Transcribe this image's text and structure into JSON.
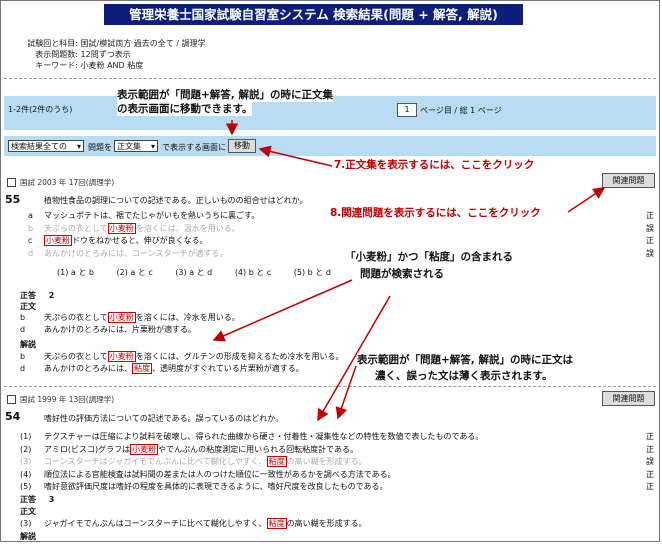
{
  "title": "管理栄養士国家試験自習室システム 検索結果(問題 + 解答, 解説)",
  "meta": {
    "subject_label": "試験回と科目:",
    "subject_value": "国試/模試両方 過去の全て / 調理学",
    "count_label": "表示問題数:",
    "count_value": "12問ずつ表示",
    "keyword_label": "キーワード:",
    "keyword_value": "小麦粉 AND 粘度"
  },
  "pagebar": {
    "range": "1-2件(2件のうち)",
    "page_value": "1",
    "page_suffix": "ページ目 / 総 1 ページ"
  },
  "controls": {
    "select1": "検索結果全ての",
    "mid_text": "問題を",
    "select2": "正文集",
    "after_text": "で表示する画面に",
    "move_button": "移動"
  },
  "q1": {
    "header": "国試 2003 年 17回(調理学)",
    "number": "55",
    "stem": "植物性食品の調理についての記述である。正しいものの組合せはどれか。",
    "related_button": "関連問題",
    "options": [
      {
        "letter": "a",
        "pre": "マッシュポテトは、裾でたじゃがいもを熱いうちに裏ごす。",
        "kw": "",
        "post": "",
        "mark": "正",
        "gray": false
      },
      {
        "letter": "b",
        "pre": "天ぷらの衣として",
        "kw": "小麦粉",
        "post": "を溶くには、温水を用いる。",
        "mark": "誤",
        "gray": true
      },
      {
        "letter": "c",
        "pre": "",
        "kw": "小麦粉",
        "post": "ドウをねかせると、伸びが良くなる。",
        "mark": "正",
        "gray": false
      },
      {
        "letter": "d",
        "pre": "あんかけのとろみには、コーンスターチが適する。",
        "kw": "",
        "post": "",
        "mark": "誤",
        "gray": true
      }
    ],
    "choices": [
      "(1) a と b",
      "(2) a と c",
      "(3) a と d",
      "(4) b と c",
      "(5) b と d"
    ],
    "answer_label": "正答",
    "answer_value": "2",
    "text_label": "正文",
    "correct": [
      {
        "letter": "b",
        "pre": "天ぷらの衣として",
        "kw": "小麦粉",
        "post": "を溶くには、冷水を用いる。"
      },
      {
        "letter": "d",
        "pre": "あんかけのとろみには、片栗粉が適する。",
        "kw": "",
        "post": ""
      }
    ],
    "explain_label": "解説",
    "explain": [
      {
        "letter": "b",
        "pre": "天ぷらの衣として",
        "kw": "小麦粉",
        "post": "を溶くには、グルテンの形成を抑えるため冷水を用いる。"
      },
      {
        "letter": "d",
        "pre": "あんかけのとろみには、",
        "kw": "粘度",
        "post": "、透明度がすぐれている片栗粉が適する。"
      }
    ]
  },
  "q2": {
    "header": "国試 1999 年 13回(調理学)",
    "number": "54",
    "stem": "嗜好性の評価方法についての記述である。誤っているのはどれか。",
    "related_button": "関連問題",
    "options": [
      {
        "letter": "(1)",
        "pre": "テクスチャーは圧縮により試料を破壊し、得られた曲線から硬さ・付着性・凝集性などの特性を数値で表したものである。",
        "kw": "",
        "post": "",
        "mark": "正",
        "gray": false
      },
      {
        "letter": "(2)",
        "pre": "アミロ(ビスコ)グラフは",
        "kw": "小麦粉",
        "post": "やでんぷんの粘度測定に用いられる回転粘度計である。",
        "mark": "正",
        "gray": false
      },
      {
        "letter": "(3)",
        "pre": "コーンスターチはジャガイモでんぷんに比べて糊化しやすく、",
        "kw": "粘度",
        "post": "の高い糊を形成する。",
        "mark": "誤",
        "gray": true
      },
      {
        "letter": "(4)",
        "pre": "順位法による官能検査は試料間の差または人のつけた順位に一致性があるかを調べる方法である。",
        "kw": "",
        "post": "",
        "mark": "正",
        "gray": false
      },
      {
        "letter": "(5)",
        "pre": "嗜好意欲評価尺度は嗜好の程度を具体的に表現できるように、嗜好尺度を改良したものである。",
        "kw": "",
        "post": "",
        "mark": "正",
        "gray": false
      }
    ],
    "answer_label": "正答",
    "answer_value": "3",
    "text_label": "正文",
    "correct": [
      {
        "letter": "(3)",
        "pre": "ジャガイモでんぷんはコーンスターチに比べて糊化しやすく、",
        "kw": "粘度",
        "post": "の高い糊を形成する。"
      }
    ],
    "explain_label": "解説"
  },
  "annotations": {
    "a1_l1": "表示範囲が「問題+解答, 解説」の時に正文集",
    "a1_l2": "の表示画面に移動できます。",
    "a7": "7.正文集を表示するには、ここをクリック",
    "a8": "8.関連問題を表示するには、ここをクリック",
    "a_search_l1": "「小麦粉」かつ「粘度」の含まれる",
    "a_search_l2": "問題が検索される",
    "a_display_l1": "表示範囲が「問題+解答, 解説」の時に正文は",
    "a_display_l2": "濃く、誤った文は薄く表示されます。"
  },
  "colors": {
    "title_bg": "#0d1f7a",
    "bar_bg": "#b7dcf3",
    "keyword": "#d00000",
    "annotation_red": "#c00000"
  }
}
